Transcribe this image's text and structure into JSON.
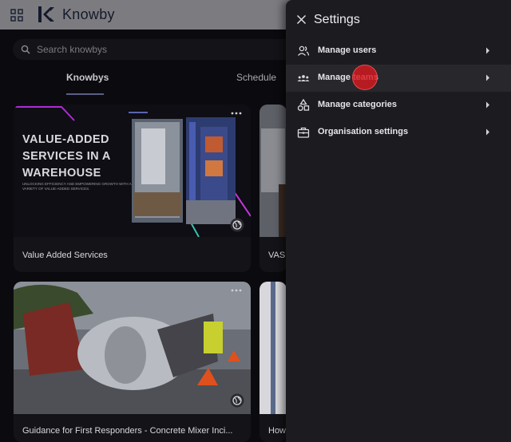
{
  "header": {
    "app_name": "Knowby",
    "icons": {
      "apps": "apps-grid-icon",
      "logo": "knowby-logo-icon"
    }
  },
  "search": {
    "placeholder": "Search knowbys",
    "value": ""
  },
  "tabs": [
    {
      "label": "Knowbys",
      "selected": true
    },
    {
      "label": "Schedule",
      "selected": false
    }
  ],
  "cards": [
    {
      "title": "Value Added Services",
      "thumbnail_heading": "VALUE-ADDED SERVICES IN A WAREHOUSE",
      "thumbnail_subtext": "UNLOCKING EFFICIENCY AND EMPOWERING GROWTH WITH A VARIETY OF VALUE-ADDED SERVICES."
    },
    {
      "title": "VAS"
    },
    {
      "title": "Guidance for First Responders - Concrete Mixer Inci..."
    },
    {
      "title": "How"
    }
  ],
  "settings": {
    "title": "Settings",
    "items": [
      {
        "label": "Manage users",
        "icon": "users-icon",
        "active": false
      },
      {
        "label": "Manage teams",
        "icon": "teams-icon",
        "active": true
      },
      {
        "label": "Manage categories",
        "icon": "categories-icon",
        "active": false
      },
      {
        "label": "Organisation settings",
        "icon": "briefcase-icon",
        "active": false
      }
    ]
  },
  "colors": {
    "drawer_bg": "#1c1c20",
    "active_row": "#27272c",
    "header_bg": "#7c7c80",
    "accent_underline": "#5b5f86",
    "click_marker": "#d71820"
  }
}
